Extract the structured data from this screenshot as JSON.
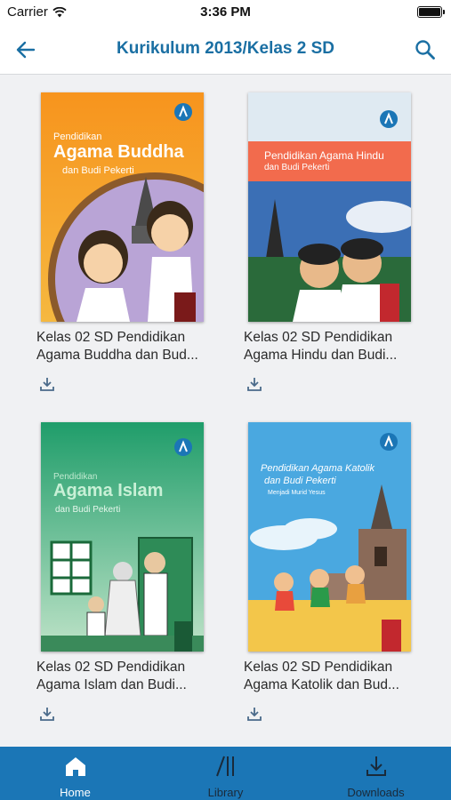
{
  "status_bar": {
    "carrier": "Carrier",
    "time": "3:36 PM"
  },
  "header": {
    "title": "Kurikulum 2013/Kelas 2 SD"
  },
  "books": [
    {
      "title_line1": "Kelas 02 SD Pendidikan",
      "title_line2": "Agama Buddha dan Bud...",
      "cover": {
        "small": "Pendidikan",
        "big": "Agama Buddha",
        "sub": "dan Budi Pekerti"
      }
    },
    {
      "title_line1": "Kelas 02 SD Pendidikan",
      "title_line2": "Agama Hindu dan Budi...",
      "cover": {
        "small": "",
        "big": "Pendidikan Agama Hindu",
        "sub": "dan Budi Pekerti"
      }
    },
    {
      "title_line1": "Kelas 02 SD Pendidikan",
      "title_line2": "Agama Islam dan Budi...",
      "cover": {
        "small": "Pendidikan",
        "big": "Agama Islam",
        "sub": "dan Budi Pekerti"
      }
    },
    {
      "title_line1": "Kelas 02 SD Pendidikan",
      "title_line2": "Agama Katolik dan Bud...",
      "cover": {
        "small": "",
        "big": "Pendidikan Agama Katolik",
        "big2": "dan Budi Pekerti",
        "sub": "Menjadi Murid Yesus"
      }
    }
  ],
  "tabs": [
    {
      "label": "Home",
      "icon": "home-icon"
    },
    {
      "label": "Library",
      "icon": "library-icon"
    },
    {
      "label": "Downloads",
      "icon": "download-icon"
    }
  ],
  "colors": {
    "accent": "#1a6fa3",
    "tab_bar": "#1b76b6"
  }
}
